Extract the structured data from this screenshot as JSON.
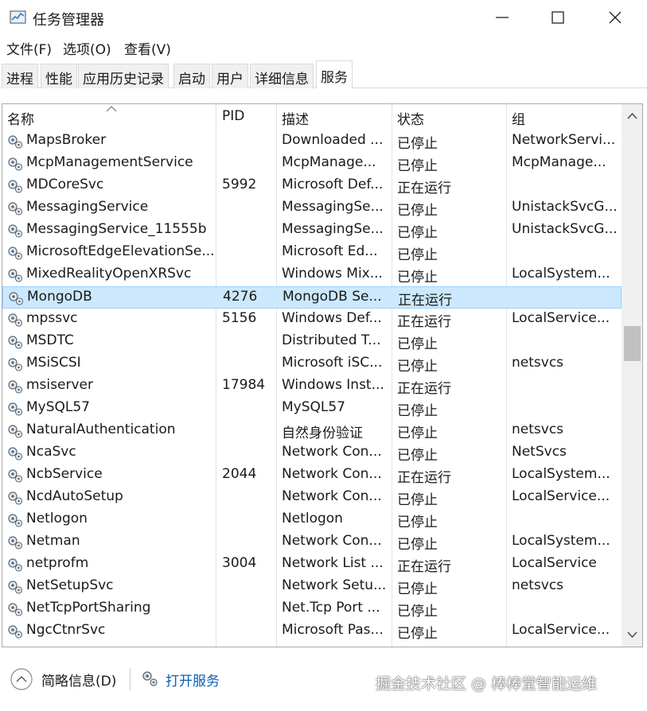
{
  "window": {
    "title": "任务管理器",
    "icon": "task-manager-icon",
    "controls": {
      "minimize": "minimize-icon",
      "maximize": "maximize-icon",
      "close": "close-icon"
    }
  },
  "menu": [
    "文件(F)",
    "选项(O)",
    "查看(V)"
  ],
  "tabs": [
    "进程",
    "性能",
    "应用历史记录",
    "启动",
    "用户",
    "详细信息",
    "服务"
  ],
  "active_tab": "服务",
  "columns": {
    "name": "名称",
    "pid": "PID",
    "desc": "描述",
    "status": "状态",
    "group": "组"
  },
  "sort_indicator": "sort-up-icon",
  "selected_row": "MongoDB",
  "rows": [
    {
      "name": "MapsBroker",
      "pid": "",
      "desc": "Downloaded ...",
      "status": "已停止",
      "group": "NetworkServi..."
    },
    {
      "name": "McpManagementService",
      "pid": "",
      "desc": "McpManage...",
      "status": "已停止",
      "group": "McpManage..."
    },
    {
      "name": "MDCoreSvc",
      "pid": "5992",
      "desc": "Microsoft Def...",
      "status": "正在运行",
      "group": ""
    },
    {
      "name": "MessagingService",
      "pid": "",
      "desc": "MessagingSe...",
      "status": "已停止",
      "group": "UnistackSvcG..."
    },
    {
      "name": "MessagingService_11555b",
      "pid": "",
      "desc": "MessagingSe...",
      "status": "已停止",
      "group": "UnistackSvcG..."
    },
    {
      "name": "MicrosoftEdgeElevationSe...",
      "pid": "",
      "desc": "Microsoft Ed...",
      "status": "已停止",
      "group": ""
    },
    {
      "name": "MixedRealityOpenXRSvc",
      "pid": "",
      "desc": "Windows Mix...",
      "status": "已停止",
      "group": "LocalSystem..."
    },
    {
      "name": "MongoDB",
      "pid": "4276",
      "desc": "MongoDB Se...",
      "status": "正在运行",
      "group": ""
    },
    {
      "name": "mpssvc",
      "pid": "5156",
      "desc": "Windows Def...",
      "status": "正在运行",
      "group": "LocalService..."
    },
    {
      "name": "MSDTC",
      "pid": "",
      "desc": "Distributed T...",
      "status": "已停止",
      "group": ""
    },
    {
      "name": "MSiSCSI",
      "pid": "",
      "desc": "Microsoft iSC...",
      "status": "已停止",
      "group": "netsvcs"
    },
    {
      "name": "msiserver",
      "pid": "17984",
      "desc": "Windows Inst...",
      "status": "正在运行",
      "group": ""
    },
    {
      "name": "MySQL57",
      "pid": "",
      "desc": "MySQL57",
      "status": "已停止",
      "group": ""
    },
    {
      "name": "NaturalAuthentication",
      "pid": "",
      "desc": "自然身份验证",
      "status": "已停止",
      "group": "netsvcs"
    },
    {
      "name": "NcaSvc",
      "pid": "",
      "desc": "Network Con...",
      "status": "已停止",
      "group": "NetSvcs"
    },
    {
      "name": "NcbService",
      "pid": "2044",
      "desc": "Network Con...",
      "status": "正在运行",
      "group": "LocalSystem..."
    },
    {
      "name": "NcdAutoSetup",
      "pid": "",
      "desc": "Network Con...",
      "status": "已停止",
      "group": "LocalService..."
    },
    {
      "name": "Netlogon",
      "pid": "",
      "desc": "Netlogon",
      "status": "已停止",
      "group": ""
    },
    {
      "name": "Netman",
      "pid": "",
      "desc": "Network Con...",
      "status": "已停止",
      "group": "LocalSystem..."
    },
    {
      "name": "netprofm",
      "pid": "3004",
      "desc": "Network List ...",
      "status": "正在运行",
      "group": "LocalService"
    },
    {
      "name": "NetSetupSvc",
      "pid": "",
      "desc": "Network Setu...",
      "status": "已停止",
      "group": "netsvcs"
    },
    {
      "name": "NetTcpPortSharing",
      "pid": "",
      "desc": "Net.Tcp Port ...",
      "status": "已停止",
      "group": ""
    },
    {
      "name": "NgcCtnrSvc",
      "pid": "",
      "desc": "Microsoft Pas...",
      "status": "已停止",
      "group": "LocalService..."
    }
  ],
  "row_icon": "service-gear-icon",
  "scrollbar": {
    "up": "scroll-up-icon",
    "down": "scroll-down-icon",
    "position": 0.43
  },
  "bottom": {
    "fewer_details": "简略信息(D)",
    "fewer_icon": "chevron-up-circle-icon",
    "open_services": "打开服务",
    "open_icon": "services-gear-icon",
    "watermark": "掘金技术社区 @ 棒棒堂智能运维"
  },
  "colors": {
    "selection_bg": "#cce8ff",
    "selection_border": "#99d1ff",
    "link": "#0a5fb4"
  }
}
